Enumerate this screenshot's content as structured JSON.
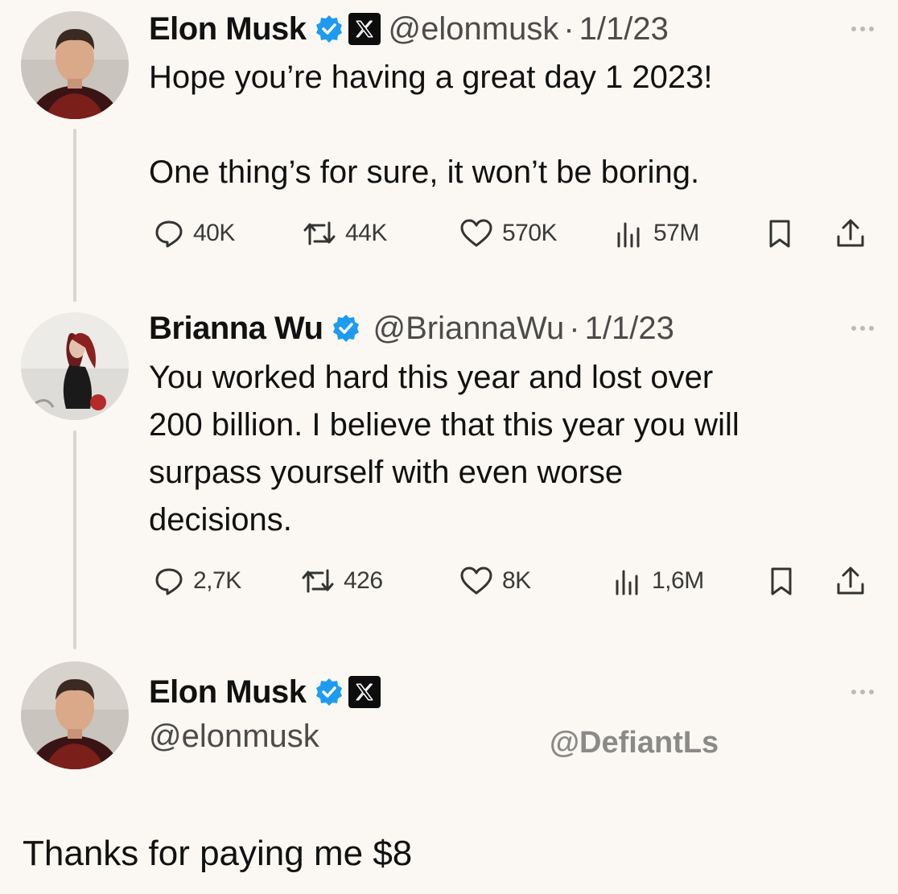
{
  "tweet1": {
    "author_name": "Elon Musk",
    "handle": "@elonmusk",
    "separator": "·",
    "date": "1/1/23",
    "text_line1": "Hope you’re having a great day 1 2023!",
    "text_line2": "One thing’s for sure, it won’t be boring.",
    "stats": {
      "replies": "40K",
      "reposts": "44K",
      "likes": "570K",
      "views": "57M"
    }
  },
  "tweet2": {
    "author_name": "Brianna Wu",
    "handle": "@BriannaWu",
    "separator": "·",
    "date": "1/1/23",
    "text_lines": [
      "You worked hard this year and lost over",
      "200 billion. I believe that this year you will",
      "surpass yourself with even worse",
      "decisions."
    ],
    "stats": {
      "replies": "2,7K",
      "reposts": "426",
      "likes": "8K",
      "views": "1,6M"
    }
  },
  "tweet3": {
    "author_name": "Elon Musk",
    "handle": "@elonmusk",
    "watermark": "@DefiantLs",
    "text": "Thanks for paying me $8"
  },
  "icons": {
    "verified": "verified-badge-icon",
    "x_logo": "x-logo-icon",
    "reply": "reply-icon",
    "repost": "repost-icon",
    "like": "heart-icon",
    "views": "views-icon",
    "bookmark": "bookmark-icon",
    "share": "share-icon",
    "more": "more-icon"
  },
  "colors": {
    "background": "#fbf8f3",
    "verified_blue": "#1d9bf0",
    "text": "#111111",
    "secondary_text": "#4b4b4b"
  }
}
